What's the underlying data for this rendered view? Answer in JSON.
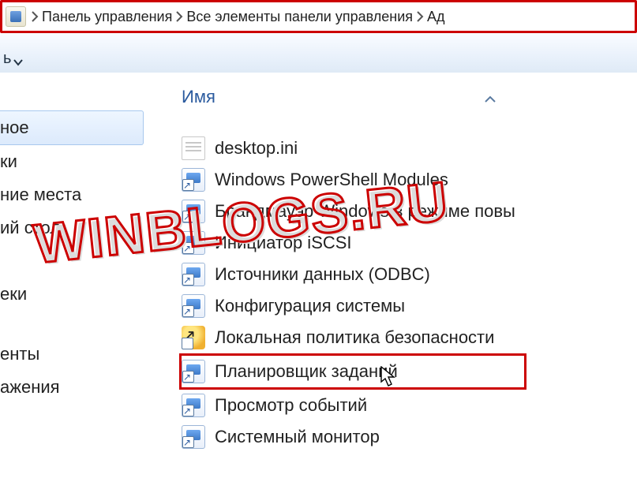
{
  "breadcrumb": {
    "items": [
      "Панель управления",
      "Все элементы панели управления",
      "Ад"
    ]
  },
  "toolbar": {
    "fragment": "ь"
  },
  "sidebar": {
    "items": [
      {
        "label": "ное",
        "selected": true
      },
      {
        "label": "ки"
      },
      {
        "label": "ние места"
      },
      {
        "label": "ий стол"
      }
    ],
    "groups": [
      {
        "label": "еки"
      },
      {
        "label": "енты"
      },
      {
        "label": "ажения"
      }
    ]
  },
  "content": {
    "column_header": "Имя",
    "rows": [
      {
        "icon": "ini",
        "label": "desktop.ini"
      },
      {
        "icon": "shortcut",
        "label": "Windows PowerShell Modules"
      },
      {
        "icon": "shortcut",
        "label": "Брандмауэр Windows в режиме повы"
      },
      {
        "icon": "shortcut",
        "label": "Инициатор iSCSI"
      },
      {
        "icon": "shortcut",
        "label": "Источники данных (ODBC)"
      },
      {
        "icon": "shortcut",
        "label": "Конфигурация системы"
      },
      {
        "icon": "shield",
        "label": "Локальная политика безопасности"
      },
      {
        "icon": "shortcut",
        "label": "Планировщик заданий",
        "highlight": true
      },
      {
        "icon": "shortcut",
        "label": "Просмотр событий"
      },
      {
        "icon": "shortcut",
        "label": "Системный монитор"
      }
    ]
  },
  "watermark": "WINBLOGS.RU"
}
